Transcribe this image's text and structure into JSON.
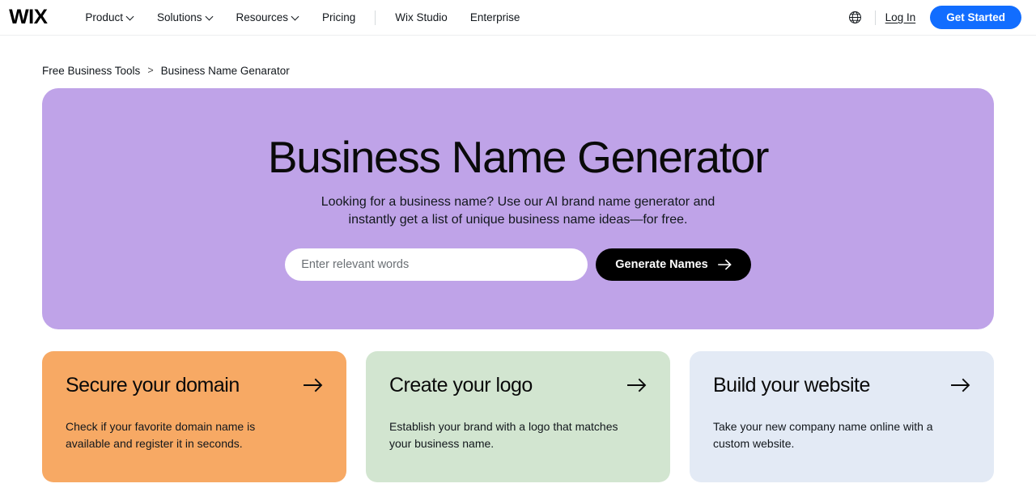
{
  "header": {
    "brand": "WIX",
    "nav_items": [
      {
        "label": "Product",
        "has_dropdown": true
      },
      {
        "label": "Solutions",
        "has_dropdown": true
      },
      {
        "label": "Resources",
        "has_dropdown": true
      },
      {
        "label": "Pricing",
        "has_dropdown": false
      }
    ],
    "nav_items_secondary": [
      {
        "label": "Wix Studio"
      },
      {
        "label": "Enterprise"
      }
    ],
    "globe_icon": "globe-icon",
    "login_label": "Log In",
    "get_started_label": "Get Started",
    "accent_color": "#116DFF"
  },
  "breadcrumb": {
    "parent": "Free Business Tools",
    "separator": ">",
    "current": "Business Name Genarator"
  },
  "hero": {
    "background_color": "#BFA3E8",
    "title": "Business Name Generator",
    "subtitle": "Looking for a business name? Use our AI brand name generator and instantly get a list of unique business name ideas—for free.",
    "input_placeholder": "Enter relevant words",
    "input_value": "",
    "submit_label": "Generate Names",
    "submit_icon": "arrow-right-icon"
  },
  "cards": [
    {
      "title": "Secure your domain",
      "description": "Check if your favorite domain name is available and register it in seconds.",
      "color": "#F7A964",
      "icon": "arrow-right-icon"
    },
    {
      "title": "Create your logo",
      "description": "Establish your brand with a logo that matches your business name.",
      "color": "#D2E5D0",
      "icon": "arrow-right-icon"
    },
    {
      "title": "Build your website",
      "description": "Take your new company name online with a custom website.",
      "color": "#E3EAF5",
      "icon": "arrow-right-icon"
    }
  ]
}
